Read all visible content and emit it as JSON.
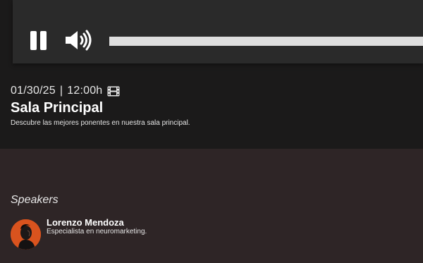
{
  "player": {
    "pause_icon": "pause-icon",
    "volume_icon": "volume-high-icon",
    "progress_fraction": 1.0
  },
  "event": {
    "date": "01/30/25",
    "separator": "|",
    "time": "12:00h",
    "type_icon": "film-icon",
    "title": "Sala Principal",
    "description": "Descubre las mejores ponentes en nuestra sala principal."
  },
  "speakers": {
    "heading": "Speakers",
    "items": [
      {
        "name": "Lorenzo Mendoza",
        "role": "Especialista en neuromarketing.",
        "avatar_color": "#d9531e"
      }
    ]
  },
  "colors": {
    "top_bg": "#1b1a1a",
    "player_bg": "#2a2a2a",
    "bottom_bg": "#2e2526",
    "progress": "#dedede"
  }
}
